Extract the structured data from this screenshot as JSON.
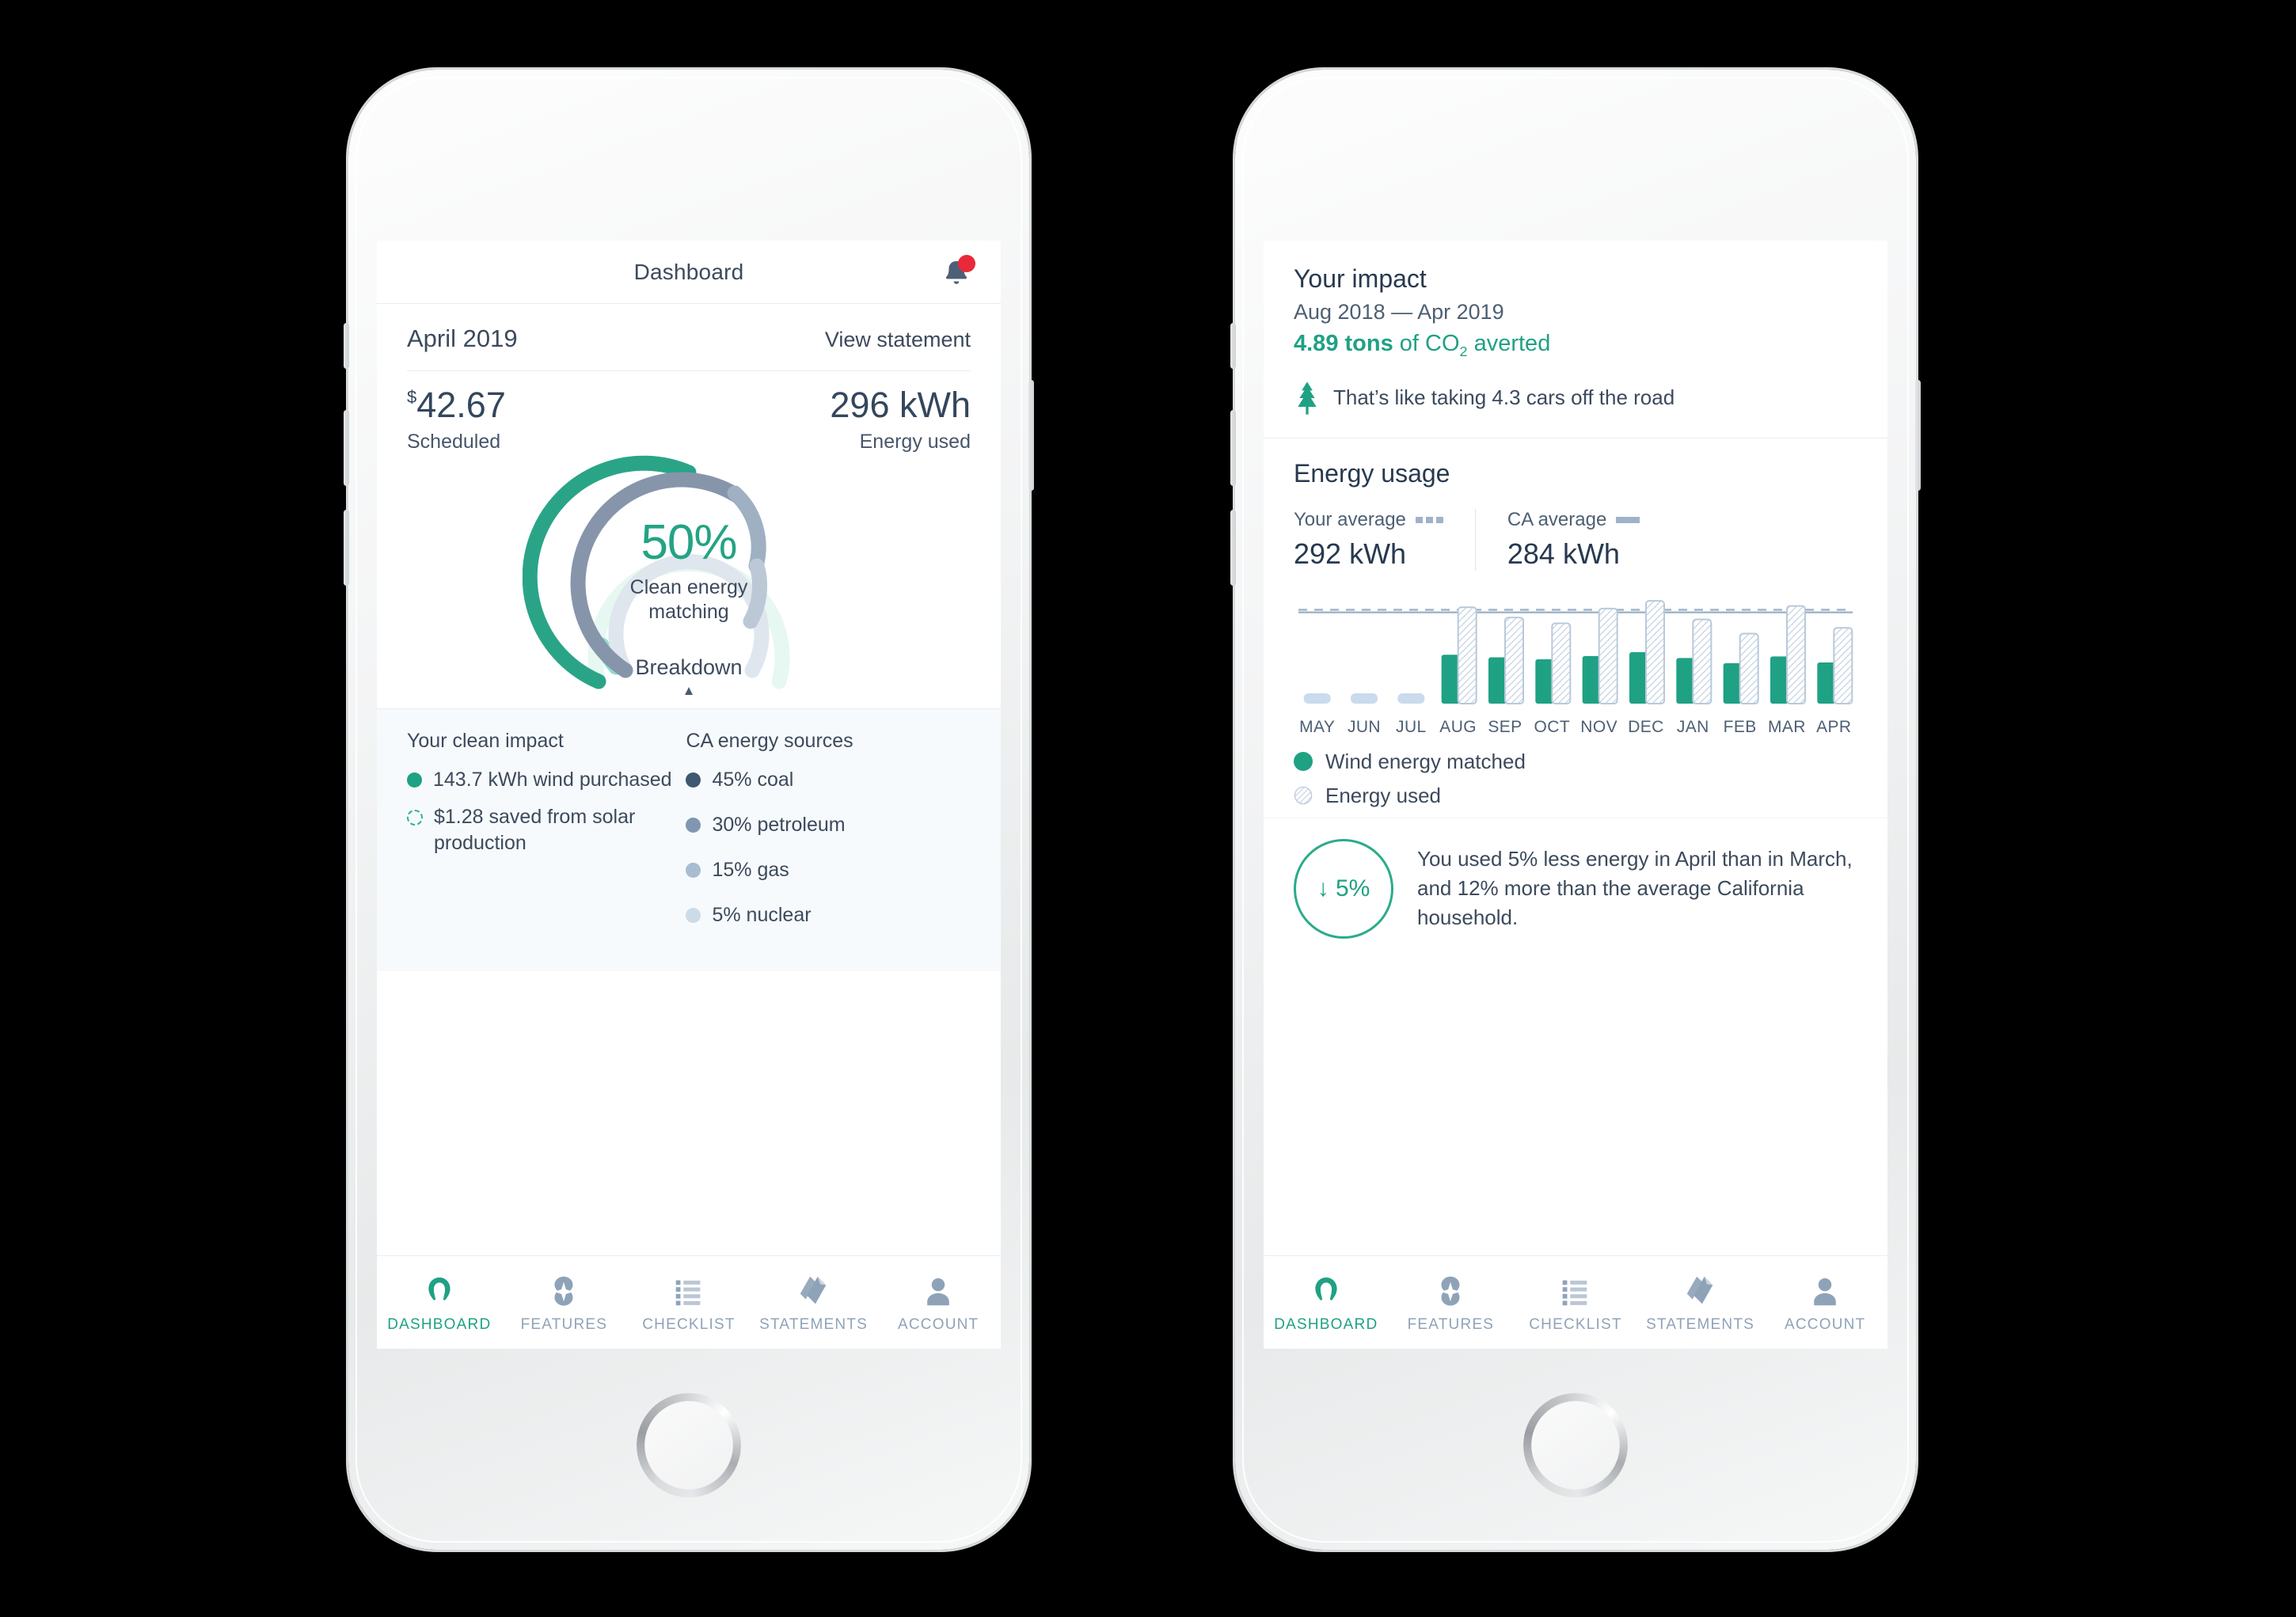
{
  "colors": {
    "teal": "#1fa184",
    "teal_light": "#8fe0c9",
    "teal_pale": "#e6f8f1",
    "slate": "#3c4a5c",
    "slate_dark": "#27394f",
    "blue_grey": "#8197b0",
    "muted": "#9fb3c8",
    "badge_red": "#e8293a"
  },
  "left_phone": {
    "header": {
      "title": "Dashboard",
      "bell_icon": "bell-icon",
      "badge_icon": "notification-dot"
    },
    "summary": {
      "month": "April 2019",
      "view_statement": "View statement",
      "amount_currency": "$",
      "amount": "42.67",
      "amount_label": "Scheduled",
      "energy": "296 kWh",
      "energy_label": "Energy used"
    },
    "gauge": {
      "percent": "50%",
      "sub_line1": "Clean energy",
      "sub_line2": "matching",
      "breakdown_label": "Breakdown",
      "caret_icon": "caret-up-icon",
      "outer_value": 50,
      "inner_value": 62
    },
    "breakdown": {
      "left_heading": "Your clean impact",
      "left_items": [
        {
          "marker": "solid-teal",
          "text": "143.7 kWh wind purchased"
        },
        {
          "marker": "dashed-teal",
          "text": "$1.28 saved from solar production"
        }
      ],
      "right_heading": "CA energy sources",
      "right_items": [
        {
          "marker": "c-coal",
          "text": "45% coal"
        },
        {
          "marker": "c-petro",
          "text": "30% petroleum"
        },
        {
          "marker": "c-gas",
          "text": "15% gas"
        },
        {
          "marker": "c-nuc",
          "text": "5% nuclear"
        }
      ]
    }
  },
  "right_phone": {
    "impact": {
      "heading": "Your impact",
      "range": "Aug 2018 — Apr 2019",
      "co2_value": "4.89 tons",
      "co2_rest_a": " of CO",
      "co2_sub": "2",
      "co2_rest_b": " averted",
      "tree_icon": "tree-icon",
      "note": "That’s like taking 4.3 cars off the road"
    },
    "energy_usage": {
      "heading": "Energy usage",
      "your_average_label": "Your average",
      "your_average_value": "292 kWh",
      "ca_average_label": "CA average",
      "ca_average_value": "284 kWh",
      "your_average_marker": "dotted-line-marker",
      "ca_average_marker": "solid-line-marker"
    },
    "legend": [
      {
        "marker": "teal",
        "text": "Wind energy matched"
      },
      {
        "marker": "hatched",
        "text": "Energy used"
      }
    ],
    "summary_note": {
      "badge_arrow": "↓",
      "badge_value": "5%",
      "text": "You used 5% less energy in April than in March, and 12% more than the average California household."
    }
  },
  "tabbar": {
    "items": [
      {
        "label": "DASHBOARD",
        "icon": "gauge-icon",
        "active": true
      },
      {
        "label": "FEATURES",
        "icon": "compass-icon",
        "active": false
      },
      {
        "label": "CHECKLIST",
        "icon": "checklist-icon",
        "active": false
      },
      {
        "label": "STATEMENTS",
        "icon": "documents-icon",
        "active": false
      },
      {
        "label": "ACCOUNT",
        "icon": "person-icon",
        "active": false
      }
    ]
  },
  "chart_data": {
    "type": "bar",
    "title": "Energy usage",
    "xlabel": "",
    "ylabel": "kWh",
    "categories": [
      "MAY",
      "JUN",
      "JUL",
      "AUG",
      "SEP",
      "OCT",
      "NOV",
      "DEC",
      "JAN",
      "FEB",
      "MAR",
      "APR"
    ],
    "series": [
      {
        "name": "Wind energy matched",
        "color": "#1fa184",
        "values": [
          0,
          0,
          0,
          152,
          144,
          138,
          148,
          160,
          142,
          126,
          147,
          128
        ]
      },
      {
        "name": "Energy used",
        "color": "#c6d4e2",
        "style": "hatched",
        "values": [
          0,
          0,
          0,
          300,
          268,
          250,
          296,
          320,
          262,
          218,
          304,
          236
        ]
      }
    ],
    "reference_lines": [
      {
        "name": "Your average",
        "value": 292,
        "style": "dashed",
        "color": "#9fb3c8"
      },
      {
        "name": "CA average",
        "value": 284,
        "style": "solid",
        "color": "#9fb3c8"
      }
    ],
    "ylim": [
      0,
      340
    ],
    "grid": false,
    "legend_position": "below",
    "no_data_months": [
      "MAY",
      "JUN",
      "JUL"
    ]
  }
}
